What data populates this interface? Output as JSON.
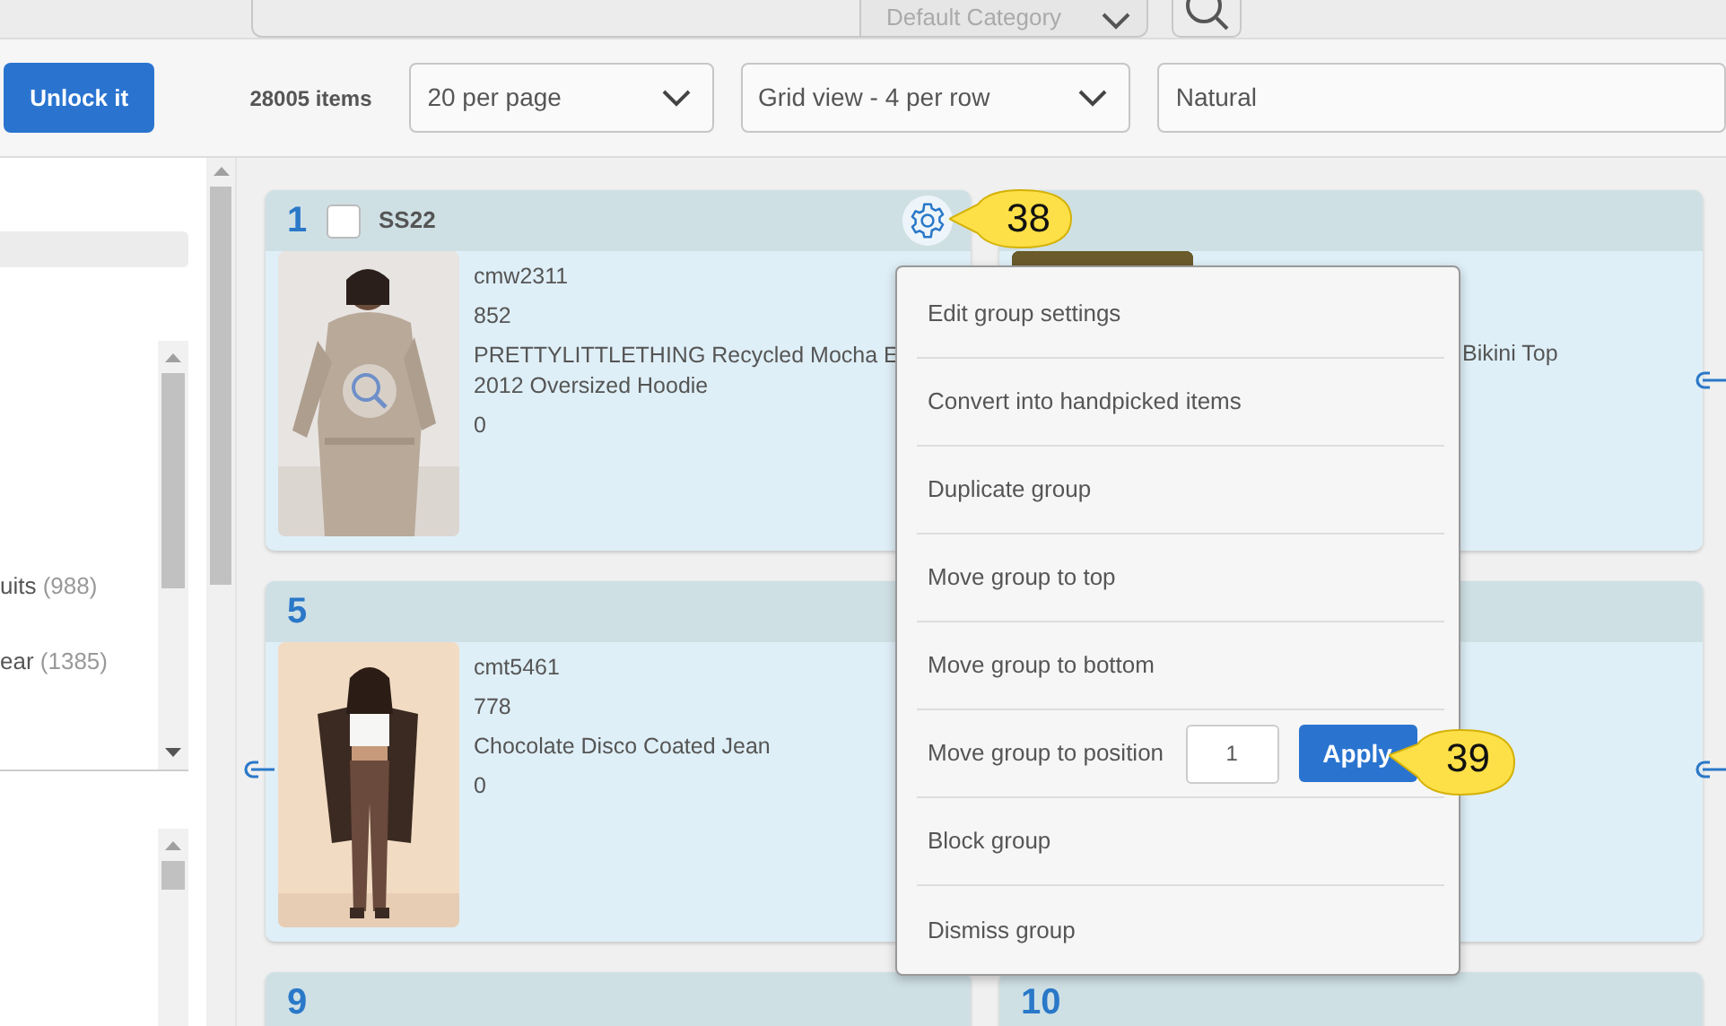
{
  "search": {
    "category": "Default Category"
  },
  "toolbar": {
    "unlock_button": "Unlock it",
    "item_count": "28005 items",
    "per_page": "20 per page",
    "view": "Grid view - 4 per row",
    "sort": "Natural"
  },
  "sidebar": {
    "categories": [
      {
        "label": "uits",
        "count": "(988)"
      },
      {
        "label": "ear",
        "count": "(1385)"
      }
    ]
  },
  "groups": [
    {
      "kind": "group",
      "number": "1",
      "checked": false,
      "name": "SS22",
      "product": {
        "sku": "cmw2311",
        "id": "852",
        "title_lines": [
          "PRETTYLITTLETHING Recycled Mocha E",
          "2012 Oversized Hoodie"
        ],
        "value": "0",
        "image": {
          "kind": "picture"
        }
      }
    },
    {
      "kind": "group",
      "product": {
        "title_lines": [
          "Bikini Top"
        ],
        "image": {
          "kind": "picture"
        }
      }
    },
    {
      "kind": "group",
      "number": "5",
      "product": {
        "sku": "cmt5461",
        "id": "778",
        "title_lines": [
          "Chocolate Disco Coated Jean"
        ],
        "value": "0",
        "image": {
          "kind": "picture"
        }
      }
    },
    {
      "kind": "group"
    },
    {
      "kind": "group",
      "number": "9"
    },
    {
      "kind": "group",
      "number": "10"
    }
  ],
  "group_menu": {
    "items": [
      {
        "kind": "action",
        "label": "Edit group settings"
      },
      {
        "kind": "action",
        "label": "Convert into handpicked items"
      },
      {
        "kind": "action",
        "label": "Duplicate group"
      },
      {
        "kind": "action",
        "label": "Move group to top"
      },
      {
        "kind": "action",
        "label": "Move group to bottom"
      },
      {
        "kind": "position",
        "label": "Move group to position",
        "value": "1",
        "button": "Apply"
      },
      {
        "kind": "action",
        "label": "Block group"
      },
      {
        "kind": "action",
        "label": "Dismiss group"
      }
    ]
  },
  "callouts": [
    {
      "number": "38"
    },
    {
      "number": "39"
    }
  ]
}
